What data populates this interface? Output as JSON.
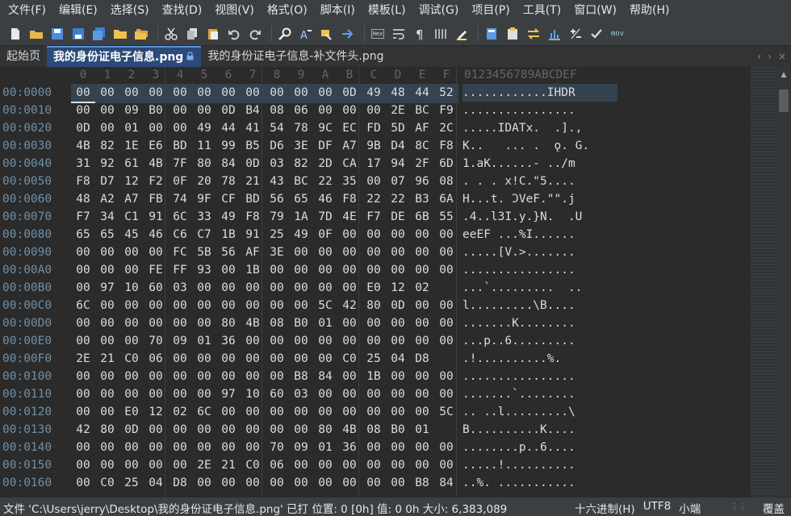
{
  "menu": [
    "文件(F)",
    "编辑(E)",
    "选择(S)",
    "查找(D)",
    "视图(V)",
    "格式(O)",
    "脚本(I)",
    "模板(L)",
    "调试(G)",
    "项目(P)",
    "工具(T)",
    "窗口(W)",
    "帮助(H)"
  ],
  "toolbar": {
    "hex_label": "Hex",
    "mov_label": "mov",
    "icons": [
      "new-file-icon",
      "open-folder-icon",
      "save-icon",
      "save-as-icon",
      "save-all-icon",
      "open-project-icon",
      "open-folders-icon",
      "cut-icon",
      "copy-icon",
      "paste-icon",
      "undo-icon",
      "redo-icon",
      "find-icon",
      "replace-icon",
      "find-in-files-icon",
      "goto-icon",
      "hex-toggle-icon",
      "word-wrap-icon",
      "show-whitespace-icon",
      "columns-icon",
      "highlight-icon",
      "calculator-icon",
      "clipboard-icon",
      "swap-icon",
      "histogram-icon",
      "plus-minus-icon",
      "checksum-icon",
      "mov-icon"
    ]
  },
  "tabs": {
    "home": "起始页",
    "active": "我的身份证电子信息.png",
    "second": "我的身份证电子信息-补文件头.png",
    "nav_left": "‹",
    "nav_right": "›",
    "close": "×"
  },
  "ruler": {
    "hex": [
      "0",
      "1",
      "2",
      "3",
      "4",
      "5",
      "6",
      "7",
      "8",
      "9",
      "A",
      "B",
      "C",
      "D",
      "E",
      "F"
    ],
    "ascii": "0123456789ABCDEF"
  },
  "rows": [
    {
      "addr": "00:0000",
      "hex": [
        "00",
        "00",
        "00",
        "00",
        "00",
        "00",
        "00",
        "00",
        "00",
        "00",
        "00",
        "0D",
        "49",
        "48",
        "44",
        "52"
      ],
      "ascii": "............IHDR"
    },
    {
      "addr": "00:0010",
      "hex": [
        "00",
        "00",
        "09",
        "B0",
        "00",
        "00",
        "0D",
        "B4",
        "08",
        "06",
        "00",
        "00",
        "00",
        "2E",
        "BC",
        "F9"
      ],
      "ascii": "................"
    },
    {
      "addr": "00:0020",
      "hex": [
        "0D",
        "00",
        "01",
        "00",
        "00",
        "49",
        "44",
        "41",
        "54",
        "78",
        "9C",
        "EC",
        "FD",
        "5D",
        "AF",
        "2C"
      ],
      "ascii": ".....IDATx.  .].,"
    },
    {
      "addr": "00:0030",
      "hex": [
        "4B",
        "82",
        "1E",
        "E6",
        "BD",
        "11",
        "99",
        "B5",
        "D6",
        "3E",
        "DF",
        "A7",
        "9B",
        "D4",
        "8C",
        "F8"
      ],
      "ascii": "K..   ... .  ǫ. G."
    },
    {
      "addr": "00:0040",
      "hex": [
        "31",
        "92",
        "61",
        "4B",
        "7F",
        "80",
        "84",
        "0D",
        "03",
        "82",
        "2D",
        "CA",
        "17",
        "94",
        "2F",
        "6D"
      ],
      "ascii": "1.aK......- ../m"
    },
    {
      "addr": "00:0050",
      "hex": [
        "F8",
        "D7",
        "12",
        "F2",
        "0F",
        "20",
        "78",
        "21",
        "43",
        "BC",
        "22",
        "35",
        "00",
        "07",
        "96",
        "08"
      ],
      "ascii": ". . . x!C.\"5...."
    },
    {
      "addr": "00:0060",
      "hex": [
        "48",
        "A2",
        "A7",
        "FB",
        "74",
        "9F",
        "CF",
        "BD",
        "56",
        "65",
        "46",
        "F8",
        "22",
        "22",
        "B3",
        "6A"
      ],
      "ascii": "H...t. ϽVeF.\"\".j"
    },
    {
      "addr": "00:0070",
      "hex": [
        "F7",
        "34",
        "C1",
        "91",
        "6C",
        "33",
        "49",
        "F8",
        "79",
        "1A",
        "7D",
        "4E",
        "F7",
        "DE",
        "6B",
        "55"
      ],
      "ascii": ".4..l3I.y.}N.  .U"
    },
    {
      "addr": "00:0080",
      "hex": [
        "65",
        "65",
        "45",
        "46",
        "C6",
        "C7",
        "1B",
        "91",
        "25",
        "49",
        "0F",
        "00",
        "00",
        "00",
        "00",
        "00"
      ],
      "ascii": "eeEF ...%I......"
    },
    {
      "addr": "00:0090",
      "hex": [
        "00",
        "00",
        "00",
        "00",
        "FC",
        "5B",
        "56",
        "AF",
        "3E",
        "00",
        "00",
        "00",
        "00",
        "00",
        "00",
        "00"
      ],
      "ascii": ".....[V.>......."
    },
    {
      "addr": "00:00A0",
      "hex": [
        "00",
        "00",
        "00",
        "FE",
        "FF",
        "93",
        "00",
        "1B",
        "00",
        "00",
        "00",
        "00",
        "00",
        "00",
        "00",
        "00"
      ],
      "ascii": "................"
    },
    {
      "addr": "00:00B0",
      "hex": [
        "00",
        "97",
        "10",
        "60",
        "03",
        "00",
        "00",
        "00",
        "00",
        "00",
        "00",
        "00",
        "E0",
        "12",
        "02"
      ],
      "ascii": "...`.........  .."
    },
    {
      "addr": "00:00C0",
      "hex": [
        "6C",
        "00",
        "00",
        "00",
        "00",
        "00",
        "00",
        "00",
        "00",
        "00",
        "5C",
        "42",
        "80",
        "0D",
        "00",
        "00"
      ],
      "ascii": "l.........\\B...."
    },
    {
      "addr": "00:00D0",
      "hex": [
        "00",
        "00",
        "00",
        "00",
        "00",
        "00",
        "80",
        "4B",
        "08",
        "B0",
        "01",
        "00",
        "00",
        "00",
        "00",
        "00"
      ],
      "ascii": ".......K........"
    },
    {
      "addr": "00:00E0",
      "hex": [
        "00",
        "00",
        "00",
        "70",
        "09",
        "01",
        "36",
        "00",
        "00",
        "00",
        "00",
        "00",
        "00",
        "00",
        "00",
        "00"
      ],
      "ascii": "...p..6........."
    },
    {
      "addr": "00:00F0",
      "hex": [
        "2E",
        "21",
        "C0",
        "06",
        "00",
        "00",
        "00",
        "00",
        "00",
        "00",
        "00",
        "C0",
        "25",
        "04",
        "D8"
      ],
      "ascii": ".!..........%.  "
    },
    {
      "addr": "00:0100",
      "hex": [
        "00",
        "00",
        "00",
        "00",
        "00",
        "00",
        "00",
        "00",
        "00",
        "B8",
        "84",
        "00",
        "1B",
        "00",
        "00",
        "00"
      ],
      "ascii": "................"
    },
    {
      "addr": "00:0110",
      "hex": [
        "00",
        "00",
        "00",
        "00",
        "00",
        "00",
        "97",
        "10",
        "60",
        "03",
        "00",
        "00",
        "00",
        "00",
        "00",
        "00"
      ],
      "ascii": ".......`........"
    },
    {
      "addr": "00:0120",
      "hex": [
        "00",
        "00",
        "E0",
        "12",
        "02",
        "6C",
        "00",
        "00",
        "00",
        "00",
        "00",
        "00",
        "00",
        "00",
        "00",
        "5C"
      ],
      "ascii": ".. ..l.........\\"
    },
    {
      "addr": "00:0130",
      "hex": [
        "42",
        "80",
        "0D",
        "00",
        "00",
        "00",
        "00",
        "00",
        "00",
        "00",
        "80",
        "4B",
        "08",
        "B0",
        "01"
      ],
      "ascii": "B..........K...."
    },
    {
      "addr": "00:0140",
      "hex": [
        "00",
        "00",
        "00",
        "00",
        "00",
        "00",
        "00",
        "00",
        "70",
        "09",
        "01",
        "36",
        "00",
        "00",
        "00",
        "00"
      ],
      "ascii": "........p..6...."
    },
    {
      "addr": "00:0150",
      "hex": [
        "00",
        "00",
        "00",
        "00",
        "00",
        "2E",
        "21",
        "C0",
        "06",
        "00",
        "00",
        "00",
        "00",
        "00",
        "00",
        "00"
      ],
      "ascii": ".....!.........."
    },
    {
      "addr": "00:0160",
      "hex": [
        "00",
        "C0",
        "25",
        "04",
        "D8",
        "00",
        "00",
        "00",
        "00",
        "00",
        "00",
        "00",
        "00",
        "00",
        "B8",
        "84"
      ],
      "ascii": "..%. ..........."
    }
  ],
  "status": {
    "file": "文件 'C:\\Users\\jerry\\Desktop\\我的身份证电子信息.png' 已打",
    "position": "位置: 0 [0h]",
    "value": "值: 0 0h",
    "size": "大小: 6,383,089",
    "mode": "十六进制(H)",
    "encoding": "UTF8",
    "endian": "小端",
    "overwrite": "覆盖"
  },
  "colors": {
    "background": "#2b2b2b",
    "menubar": "#3c3f41",
    "active_tab": "#2b4a7a",
    "address": "#6e8fa8",
    "selection": "#35424f"
  }
}
